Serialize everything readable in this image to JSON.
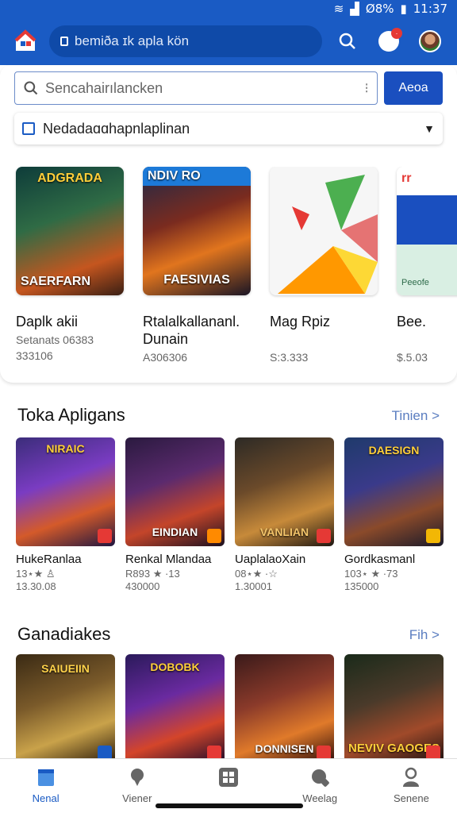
{
  "status": {
    "time": "11:37",
    "battery": "Ø8%"
  },
  "appbar": {
    "search_text": "bemiða ɪk apla kön"
  },
  "search": {
    "placeholder": "Sencahairılancken",
    "button_label": "Aeoa"
  },
  "filter": {
    "label": "Nedadaɑɑhapnlaplinan"
  },
  "featured": [
    {
      "title": "Daplk akii",
      "subtitle": "Setanats 06383",
      "price": "333106",
      "art_top": "ADGRADA",
      "art_bottom": "SAERFARN"
    },
    {
      "title": "Rtalalkallananl. Dunain",
      "subtitle": "",
      "price": "A306306",
      "art_top": "NDIV   RO",
      "art_bottom": "FAESIVIAS"
    },
    {
      "title": "Mag Rpiz",
      "subtitle": "",
      "price": "S:3.333",
      "art_top": "",
      "art_bottom": ""
    },
    {
      "title": "Bee.",
      "subtitle": "",
      "price": "$.5.03",
      "art_top": "rr",
      "art_bottom": "Peeofe"
    }
  ],
  "section1": {
    "title": "Toka Apligans",
    "link": "Tinien >",
    "items": [
      {
        "name": "HukeRanlaa",
        "rating": "13⋆★ ♙",
        "count": "13.30.08",
        "cap": "NIRAIC"
      },
      {
        "name": "Renkal Mlandaa",
        "rating": "R893 ★ ·13",
        "count": "4​30000",
        "cap": "EINDIAN"
      },
      {
        "name": "UaplalaoXain",
        "rating": "08⋆★ ·☆",
        "count": "1.30001",
        "cap": "VANLIAN"
      },
      {
        "name": "Gordkasmanl",
        "rating": "103⋆ ★ ·73",
        "count": "135000",
        "cap": "DAESIGN"
      }
    ]
  },
  "section2": {
    "title": "Ganadiakes",
    "link": "Fih >",
    "items": [
      {
        "cap": "SAIUEIIN"
      },
      {
        "cap": "DOBOBK"
      },
      {
        "cap": "DONNISEN"
      },
      {
        "cap": "NEVIV GAOGES"
      }
    ]
  },
  "nav": [
    {
      "label": "Nenal",
      "icon": "home-icon"
    },
    {
      "label": "Viener",
      "icon": "pin-icon"
    },
    {
      "label": "",
      "icon": "apps-grid-icon"
    },
    {
      "label": "Weelag",
      "icon": "game-pad-icon"
    },
    {
      "label": "Senene",
      "icon": "profile-icon"
    }
  ],
  "colors": {
    "brand": "#1a5bc4",
    "accent_orange": "#ff8a00"
  }
}
